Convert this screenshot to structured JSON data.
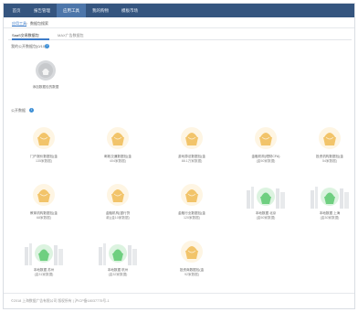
{
  "topnav": {
    "items": [
      {
        "label": "首页"
      },
      {
        "label": "报告管理"
      },
      {
        "label": "应用工具"
      },
      {
        "label": "我的购物"
      },
      {
        "label": "模板市场"
      }
    ],
    "active_index": 2
  },
  "breadcrumb": {
    "parent": "应用工具",
    "separator": ">",
    "current": "数据包搜索"
  },
  "tabs": [
    {
      "label": "SaaS交易数据包"
    },
    {
      "label": "MAX广告数据包"
    }
  ],
  "sections": {
    "private_title": "我的公开数据包(0/10)",
    "public_title": "公开数据"
  },
  "private_cards": [
    {
      "name": "添加数据包的数据",
      "count": ""
    }
  ],
  "public_cards": [
    {
      "name": "门户报价数据包(金",
      "count": "135家数据)",
      "style": "bag"
    },
    {
      "name": "邮政交通数据包(金",
      "count": "404家数据)",
      "style": "bag"
    },
    {
      "name": "游戏算法数据包(金",
      "count": "88.1万家数据)",
      "style": "bag"
    },
    {
      "name": "金融机构(理财CFA)",
      "count": "(金50家数据)",
      "style": "bag"
    },
    {
      "name": "投资机构数据包(金",
      "count": "54家数据)",
      "style": "bag"
    },
    {
      "name": "教育机构数据包(金",
      "count": "68家数据)",
      "style": "bag"
    },
    {
      "name": "金融机构(银行贷",
      "count": "款)(金10家数据)",
      "style": "bag"
    },
    {
      "name": "金融行业数据包(金",
      "count": "120家数据)",
      "style": "bag"
    },
    {
      "name": "本地数据 北京",
      "count": "(金50家数据)",
      "style": "city"
    },
    {
      "name": "本地数据 上海",
      "count": "(金30家数据)",
      "style": "city"
    },
    {
      "name": "本地数据 苏州",
      "count": "(金31家数据)",
      "style": "city"
    },
    {
      "name": "本地数据 杭州",
      "count": "(金32家数据)",
      "style": "city"
    },
    {
      "name": "投资商数据包(金",
      "count": "92家数据)",
      "style": "bag"
    }
  ],
  "footer": {
    "text": "©2018 上海数据广告有限公司 版权所有 | 沪ICP备18037775号-1"
  },
  "colors": {
    "nav_bg": "#35557f",
    "nav_active": "#4d76aa",
    "link": "#3d7cc9",
    "bag_gold": "#f2c46a",
    "bag_green": "#7bd38a"
  }
}
